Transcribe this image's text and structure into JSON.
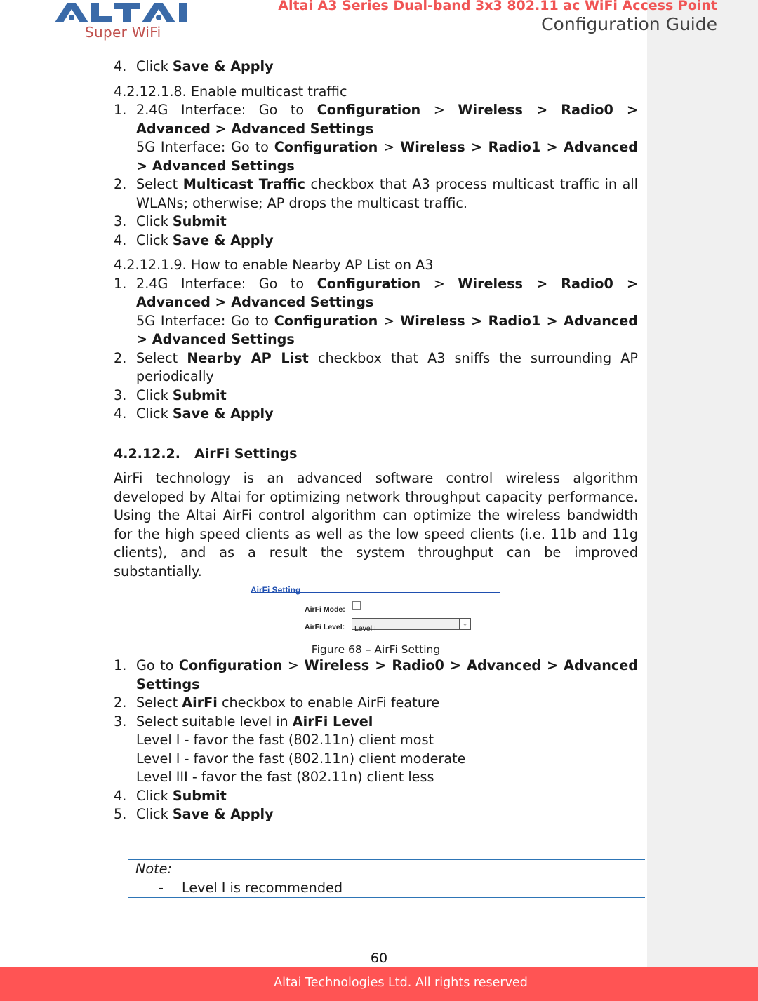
{
  "header": {
    "logo_text": "ALTAI",
    "logo_tagline": "Super WiFi",
    "doc_title": "Altai A3 Series Dual-band 3x3 802.11 ac WiFi Access Point",
    "doc_subtitle": "Configuration Guide"
  },
  "colors": {
    "brand_red": "#f05555",
    "logo_blue": "#3a6aa8",
    "footer_bg": "#ff5454",
    "note_rule": "#2e75b6",
    "figure_blue": "#1f4fb0"
  },
  "prev_section": {
    "step4_num": "4.",
    "step4_pre": "Click ",
    "step4_bold": "Save & Apply"
  },
  "sec_1218": {
    "heading": "4.2.12.1.8.  Enable multicast traffic",
    "s1_num": "1.",
    "s1_a": "2.4G Interface: Go to ",
    "s1_b": "Configuration",
    "s1_c": " > ",
    "s1_d": "Wireless > Radio0 > Advanced > Advanced Settings",
    "s1_e": "5G Interface: Go to ",
    "s1_f": "Configuration",
    "s1_g": " > ",
    "s1_h": "Wireless > Radio1 > Advanced > Advanced Settings",
    "s2_num": "2.",
    "s2_a": "Select ",
    "s2_b": "Multicast Traffic",
    "s2_c": " checkbox that A3 process multicast traffic in all WLANs; otherwise; AP drops the multicast traffic.",
    "s3_num": "3.",
    "s3_a": "Click ",
    "s3_b": "Submit",
    "s4_num": "4.",
    "s4_a": "Click ",
    "s4_b": "Save & Apply"
  },
  "sec_1219": {
    "heading": "4.2.12.1.9.  How to enable Nearby AP List on A3",
    "s1_num": "1.",
    "s1_a": "2.4G Interface: Go to ",
    "s1_b": "Configuration",
    "s1_c": " > ",
    "s1_d": "Wireless > Radio0 > Advanced > Advanced Settings",
    "s1_e": "5G Interface: Go to ",
    "s1_f": "Configuration",
    "s1_g": " > ",
    "s1_h": "Wireless > Radio1 > Advanced > Advanced Settings",
    "s2_num": "2.",
    "s2_a": "Select ",
    "s2_b": "Nearby AP List",
    "s2_c": " checkbox that A3 sniffs the surrounding AP periodically",
    "s3_num": "3.",
    "s3_a": "Click ",
    "s3_b": "Submit",
    "s4_num": "4.",
    "s4_a": "Click ",
    "s4_b": "Save & Apply"
  },
  "sec_airfi": {
    "num": "4.2.12.2.",
    "title": "AirFi Settings",
    "body": "AirFi technology is an advanced software control wireless algorithm developed by Altai for optimizing network throughput capacity performance. Using the Altai AirFi control algorithm can optimize the wireless bandwidth for the high speed clients as well as the low speed clients (i.e. 11b and 11g clients), and as a result the system throughput can be improved substantially.",
    "figure": {
      "panel_title": "AirFi Setting",
      "mode_label": "AirFi Mode:",
      "mode_checked": false,
      "level_label": "AirFi Level:",
      "level_value": "Level I",
      "caption": "Figure 68 – AirFi Setting"
    },
    "s1_num": "1.",
    "s1_a": "Go to ",
    "s1_b": "Configuration",
    "s1_c": " > ",
    "s1_d": "Wireless > Radio0 > Advanced > Advanced Settings",
    "s2_num": "2.",
    "s2_a": "Select ",
    "s2_b": "AirFi",
    "s2_c": " checkbox to enable AirFi feature",
    "s3_num": "3.",
    "s3_a": " Select suitable level in ",
    "s3_b": "AirFi Level",
    "levels": [
      "Level I - favor the fast (802.11n) client most",
      "Level I - favor the fast (802.11n) client moderate",
      "Level III - favor the fast (802.11n) client less"
    ],
    "s4_num": "4.",
    "s4_a": "Click ",
    "s4_b": "Submit",
    "s5_num": "5.",
    "s5_a": "Click ",
    "s5_b": "Save & Apply"
  },
  "note": {
    "label": "Note:",
    "dash": "-",
    "item": "Level I is recommended"
  },
  "footer": {
    "page_number": "60",
    "copyright": "Altai Technologies Ltd. All rights reserved"
  }
}
